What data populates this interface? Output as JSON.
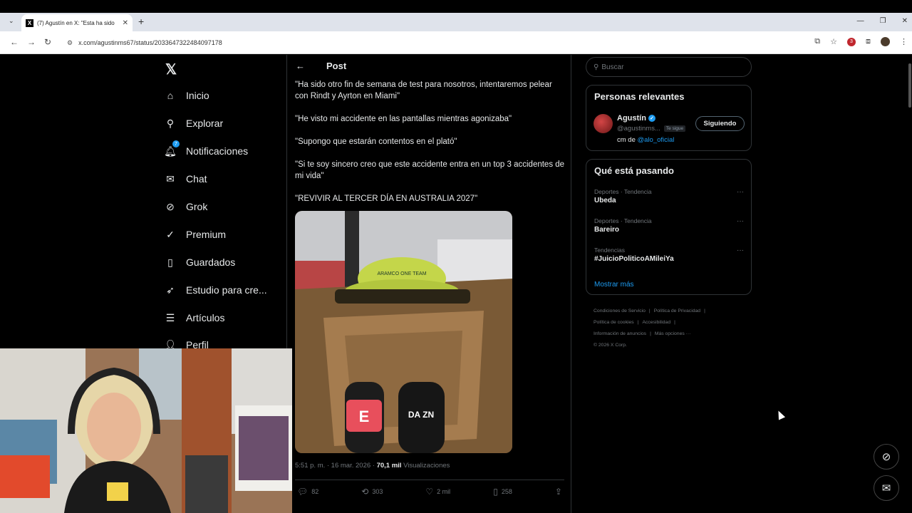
{
  "browser": {
    "tab_title": "(7) Agustín en X: \"Esta ha sido",
    "url": "x.com/agustinms67/status/2033647322484097178",
    "ext_badge": "3"
  },
  "nav": {
    "items": [
      {
        "label": "Inicio",
        "icon": "home-icon"
      },
      {
        "label": "Explorar",
        "icon": "search-icon"
      },
      {
        "label": "Notificaciones",
        "icon": "bell-icon",
        "badge": "7"
      },
      {
        "label": "Chat",
        "icon": "mail-icon"
      },
      {
        "label": "Grok",
        "icon": "grok-icon"
      },
      {
        "label": "Premium",
        "icon": "premium-icon"
      },
      {
        "label": "Guardados",
        "icon": "bookmark-icon"
      },
      {
        "label": "Estudio para cre...",
        "icon": "rocket-icon"
      },
      {
        "label": "Artículos",
        "icon": "article-icon"
      },
      {
        "label": "Perfil",
        "icon": "person-icon"
      }
    ]
  },
  "post": {
    "header": "Post",
    "lines": [
      "\"Ha sido otro fin de semana de test para nosotros, intentaremos pelear con Rindt y Ayrton en Miami\"",
      "\"He visto mi accidente en las pantallas mientras agonizaba\"",
      "\"Supongo que estarán contentos en el plató\"",
      "\"Si te soy sincero creo que este accidente entra en un top 3 accidentes de mi vida\"",
      "\"REVIVIR AL TERCER DÍA EN AUSTRALIA 2027\""
    ],
    "timestamp": "5:51 p. m. · 16 mar. 2026 · ",
    "views_count": "70,1 mil",
    "views_label": " Visualizaciones",
    "replies": "82",
    "reposts": "303",
    "likes": "2 mil",
    "bookmarks": "258"
  },
  "sidebar": {
    "search_placeholder": "Buscar",
    "relevant_title": "Personas relevantes",
    "person": {
      "name": "Agustín",
      "handle": "@agustinms...",
      "follows_you": "Te sigue",
      "bio_prefix": "cm de ",
      "bio_link": "@alo_oficial",
      "follow_label": "Siguiendo"
    },
    "trends_title": "Qué está pasando",
    "trends": [
      {
        "category": "Deportes · Tendencia",
        "name": "Ubeda"
      },
      {
        "category": "Deportes · Tendencia",
        "name": "Bareiro"
      },
      {
        "category": "Tendencias",
        "name": "#JuicioPoliticoAMileiYa"
      }
    ],
    "show_more": "Mostrar más",
    "footer": {
      "terms": "Condiciones de Servicio",
      "privacy": "Política de Privacidad",
      "cookies": "Política de cookies",
      "accessibility": "Accesibilidad",
      "ads": "Información de anuncios",
      "more": "Más opciones ···",
      "copyright": "© 2026 X Corp."
    }
  },
  "media": {
    "mic_left": "E",
    "mic_right": "DA ZN",
    "cap_text": "ARAMCO ONE TEAM"
  }
}
